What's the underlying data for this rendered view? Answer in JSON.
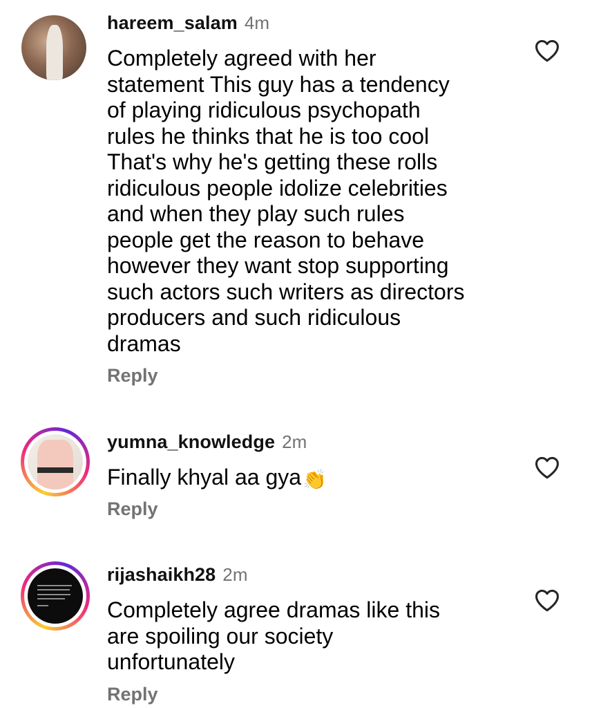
{
  "comments": [
    {
      "username": "hareem_salam",
      "time": "4m",
      "lines": [
        "Completely agreed with her",
        "statement This guy has a tendency",
        "of playing ridiculous psychopath",
        "rules he thinks that he is too cool",
        "That's why he's getting these rolls",
        "ridiculous people idolize celebrities",
        "and when they play such rules",
        "people get the reason to behave",
        "however they want stop supporting",
        "such actors such writers as directors",
        "producers and such ridiculous",
        "dramas"
      ],
      "reply_label": "Reply",
      "has_story_ring": false
    },
    {
      "username": "yumna_knowledge",
      "time": "2m",
      "lines": [
        "Finally khyal aa gya"
      ],
      "emoji": "👏",
      "reply_label": "Reply",
      "has_story_ring": true
    },
    {
      "username": "rijashaikh28",
      "time": "2m",
      "lines": [
        "Completely agree dramas like this",
        "are spoiling our society",
        "unfortunately"
      ],
      "reply_label": "Reply",
      "has_story_ring": true
    }
  ],
  "icons": {
    "like": "heart-outline-icon"
  },
  "colors": {
    "muted_text": "#737373",
    "primary_text": "#000000",
    "heart_stroke": "#262626"
  }
}
